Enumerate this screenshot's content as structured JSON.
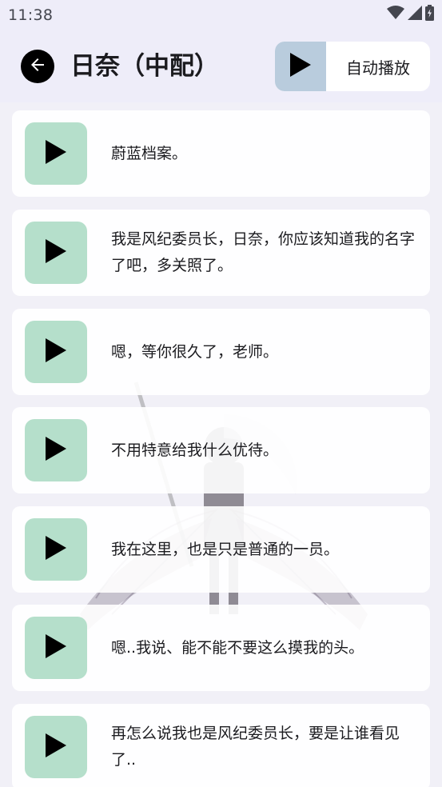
{
  "status_bar": {
    "time": "11:38",
    "icons": [
      "wifi-icon",
      "signal-icon",
      "battery-charging-icon"
    ]
  },
  "header": {
    "back_icon": "arrow-left-icon",
    "title": "日奈（中配）",
    "auto_play": {
      "icon": "play-icon",
      "label": "自动播放"
    }
  },
  "colors": {
    "background": "#f1f0f7",
    "header_background": "#eeedf9",
    "card_background": "#ffffff",
    "play_tile": "#b5dfcb",
    "auto_play_tile": "#b9ccdd",
    "text": "#1b1b1f"
  },
  "voice_lines": [
    {
      "text": "蔚蓝档案。"
    },
    {
      "text": "我是风纪委员长，日奈，你应该知道我的名字了吧，多关照了。"
    },
    {
      "text": "嗯，等你很久了，老师。"
    },
    {
      "text": "不用特意给我什么优待。"
    },
    {
      "text": "我在这里，也是只是普通的一员。"
    },
    {
      "text": "嗯..我说、能不能不要这么摸我的头。"
    },
    {
      "text": "再怎么说我也是风纪委员长，要是让谁看见了.."
    }
  ]
}
